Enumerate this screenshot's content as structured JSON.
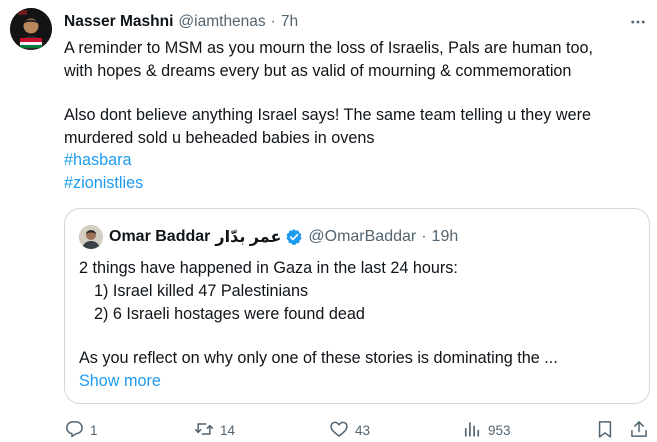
{
  "tweet": {
    "author_name": "Nasser Mashni",
    "author_handle": "@iamthenas",
    "separator": "·",
    "time": "7h",
    "lines": [
      "A reminder to MSM as you mourn the loss of Israelis, Pals are human too,",
      "with hopes & dreams every but as valid of mourning & commemoration",
      "Also dont believe anything Israel says! The same team telling u they were",
      "murdered sold u beheaded babies in ovens"
    ],
    "hashtags": [
      "#hasbara",
      "#zionistlies"
    ],
    "more_icon": "more-dots-icon"
  },
  "quote": {
    "author_name": "Omar Baddar",
    "author_name_ar": "عمر بدّار",
    "author_handle": "@OmarBaddar",
    "separator": "·",
    "time": "19h",
    "verified_color": "#1d9bf0",
    "lines": [
      "2 things have happened in Gaza in the last 24 hours:",
      "1) Israel killed 47 Palestinians",
      "2) 6 Israeli hostages were found dead",
      "As you reflect on why only one of these stories is dominating the ..."
    ],
    "show_more": "Show more"
  },
  "actions": {
    "reply_count": "1",
    "retweet_count": "14",
    "like_count": "43",
    "views_count": "953"
  },
  "colors": {
    "text": "#0f1419",
    "secondary": "#536471",
    "link": "#1d9bf0",
    "border": "#cfd9de"
  }
}
